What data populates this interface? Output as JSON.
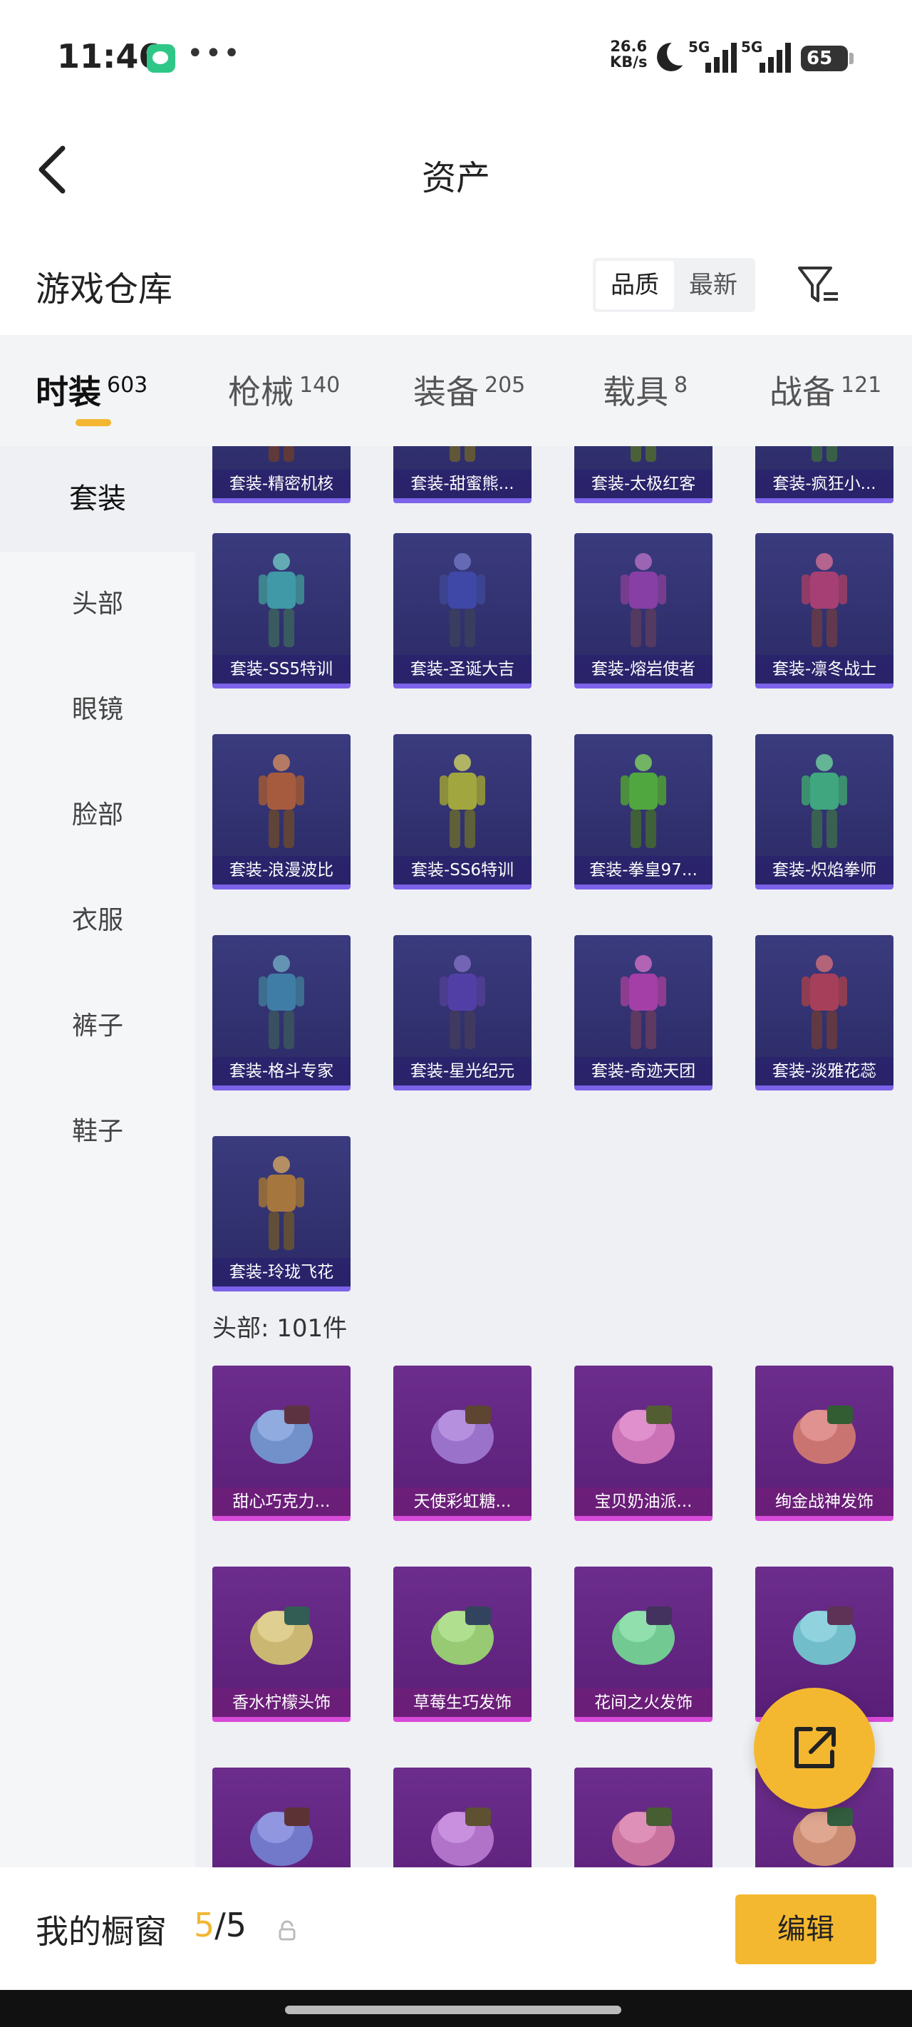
{
  "status": {
    "time": "11:46",
    "net_speed_value": "26.6",
    "net_speed_unit": "KB/s",
    "sim1": "5G",
    "sim2": "5G",
    "battery": "65"
  },
  "nav": {
    "title": "资产"
  },
  "warehouse": {
    "title": "游戏仓库",
    "sort_quality": "品质",
    "sort_latest": "最新"
  },
  "tabs": [
    {
      "label": "时装",
      "count": "603"
    },
    {
      "label": "枪械",
      "count": "140"
    },
    {
      "label": "装备",
      "count": "205"
    },
    {
      "label": "载具",
      "count": "8"
    },
    {
      "label": "战备",
      "count": "121"
    }
  ],
  "sidebar": [
    "套装",
    "头部",
    "眼镜",
    "脸部",
    "衣服",
    "裤子",
    "鞋子"
  ],
  "suits": [
    "套装-精密机核",
    "套装-甜蜜熊...",
    "套装-太极红客",
    "套装-疯狂小...",
    "套装-SS5特训",
    "套装-圣诞大吉",
    "套装-熔岩使者",
    "套装-凛冬战士",
    "套装-浪漫波比",
    "套装-SS6特训",
    "套装-拳皇97...",
    "套装-炽焰拳师",
    "套装-格斗专家",
    "套装-星光纪元",
    "套装-奇迹天团",
    "套装-淡雅花蕊",
    "套装-玲珑飞花"
  ],
  "head_section": {
    "label": "头部: 101件"
  },
  "heads": [
    "甜心巧克力...",
    "天使彩虹糖...",
    "宝贝奶油派...",
    "绚金战神发饰",
    "香水柠檬头饰",
    "草莓生巧发饰",
    "花间之火发饰",
    "",
    "",
    "",
    "",
    ""
  ],
  "bottom": {
    "title": "我的橱窗",
    "current": "5",
    "separator": "/",
    "total": "5",
    "edit": "编辑"
  },
  "colors": {
    "accent": "#f4b830",
    "suit_bg": "#2f2d6e",
    "head_bg": "#641f82"
  },
  "icons": {
    "back": "chevron-left-icon",
    "filter": "filter-icon",
    "share": "share-icon",
    "lock": "lock-icon"
  }
}
